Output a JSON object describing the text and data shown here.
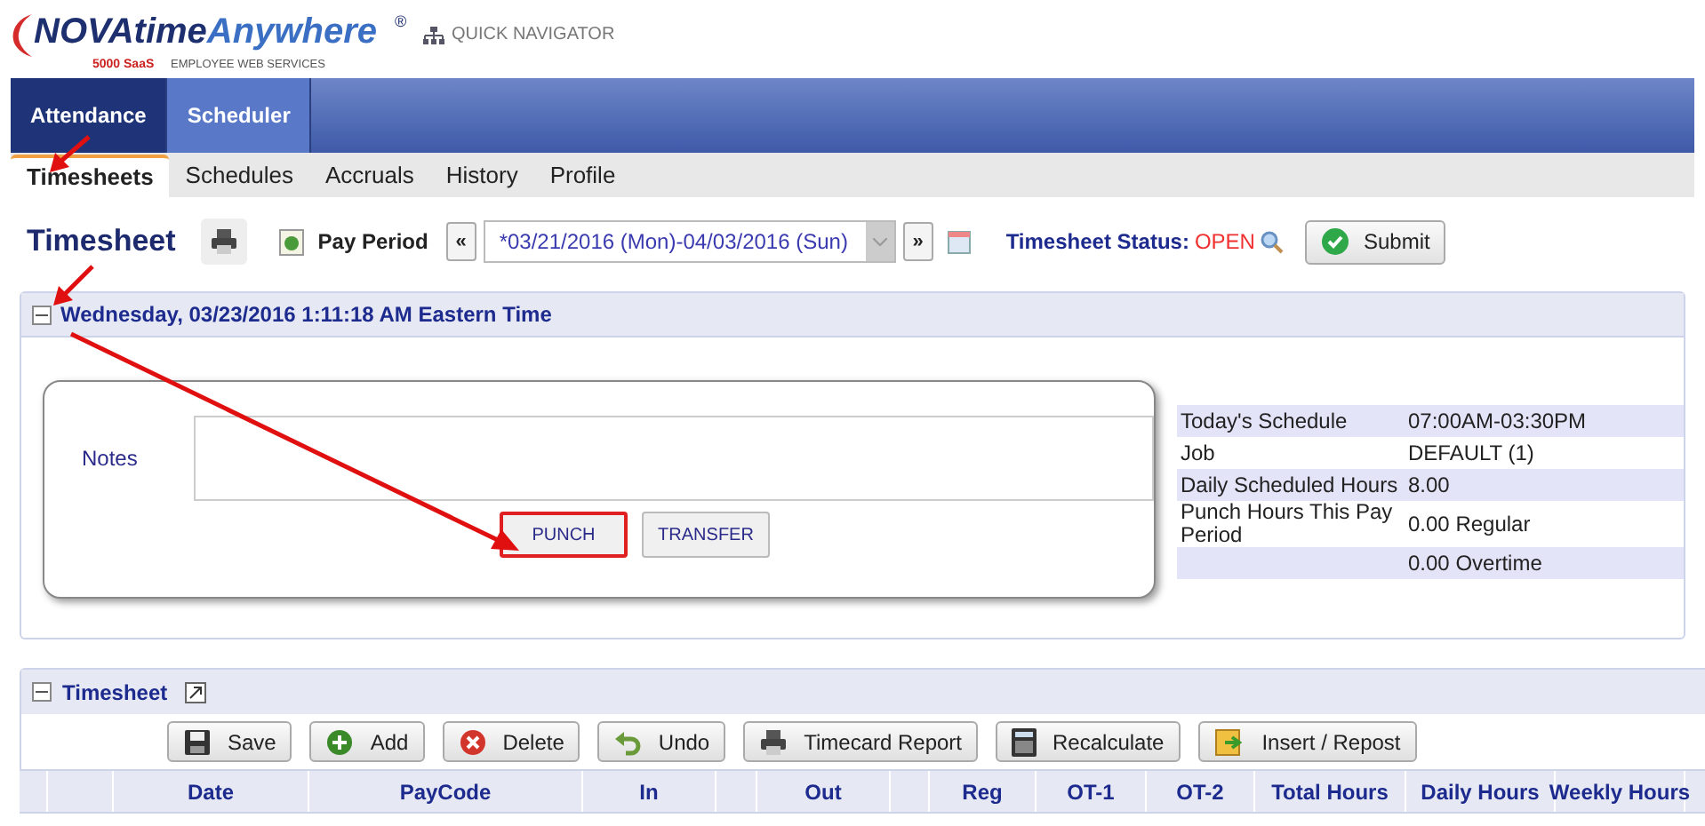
{
  "header": {
    "logo_part_1": "NOVAtime",
    "logo_part_2": "Anywhere",
    "logo_mark": "®",
    "tagline_brand": "5000 SaaS",
    "tagline": "EMPLOYEE WEB SERVICES",
    "quick_navigator": "QUICK NAVIGATOR"
  },
  "main_tabs": [
    {
      "label": "Attendance",
      "selected": true
    },
    {
      "label": "Scheduler",
      "selected": false
    }
  ],
  "sub_tabs": [
    {
      "label": "Timesheets",
      "selected": true
    },
    {
      "label": "Schedules",
      "selected": false
    },
    {
      "label": "Accruals",
      "selected": false
    },
    {
      "label": "History",
      "selected": false
    },
    {
      "label": "Profile",
      "selected": false
    }
  ],
  "toolbar": {
    "title": "Timesheet",
    "pay_period_label": "Pay Period",
    "prev": "«",
    "pay_period_value": "*03/21/2016 (Mon)-04/03/2016 (Sun)",
    "next": "»",
    "status_label": "Timesheet Status:",
    "status_value": "OPEN",
    "submit": "Submit"
  },
  "punch_section": {
    "title": "Wednesday, 03/23/2016 1:11:18 AM Eastern Time",
    "expanded": true,
    "notes_label": "Notes",
    "buttons": [
      {
        "label": "PUNCH",
        "highlighted": true
      },
      {
        "label": "TRANSFER",
        "highlighted": false
      }
    ],
    "schedule": [
      {
        "label": "Today's Schedule",
        "value": "07:00AM-03:30PM"
      },
      {
        "label": "Job",
        "value": "DEFAULT (1)"
      },
      {
        "label": "Daily Scheduled Hours",
        "value": "8.00"
      },
      {
        "label": "Punch Hours This Pay Period",
        "value": "0.00 Regular"
      },
      {
        "value": "0.00 Overtime"
      }
    ]
  },
  "timesheet_section": {
    "title": "Timesheet",
    "expanded": true,
    "buttons": [
      {
        "label": "Save",
        "kind": "save"
      },
      {
        "label": "Add",
        "kind": "add"
      },
      {
        "label": "Delete",
        "kind": "delete"
      },
      {
        "label": "Undo",
        "kind": "undo"
      },
      {
        "label": "Timecard Report",
        "kind": "print"
      },
      {
        "label": "Recalculate",
        "kind": "calculator"
      },
      {
        "label": "Insert / Repost",
        "kind": "insert"
      }
    ],
    "columns": [
      {
        "kind": "spacer"
      },
      {
        "kind": "spacer"
      },
      {
        "kind": "heading",
        "label": "Date"
      },
      {
        "kind": "heading",
        "label": "PayCode"
      },
      {
        "kind": "heading",
        "label": "In"
      },
      {
        "kind": "spacer"
      },
      {
        "kind": "heading",
        "label": "Out"
      },
      {
        "kind": "spacer"
      },
      {
        "kind": "heading",
        "label": "Reg"
      },
      {
        "kind": "heading",
        "label": "OT-1"
      },
      {
        "kind": "heading",
        "label": "OT-2"
      },
      {
        "kind": "heading",
        "label": "Total Hours"
      },
      {
        "kind": "heading",
        "label": "Daily Hours"
      },
      {
        "kind": "heading",
        "label": "Weekly Hours"
      }
    ]
  }
}
